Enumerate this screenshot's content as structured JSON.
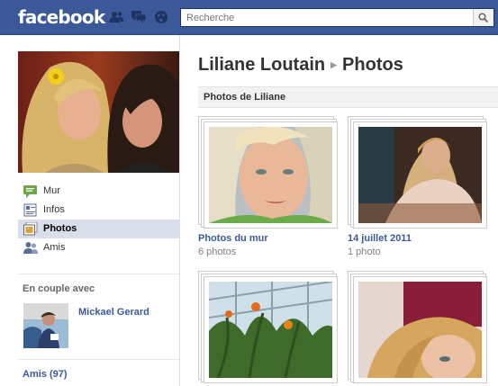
{
  "topbar": {
    "logo": "facebook",
    "search_placeholder": "Recherche",
    "jewels": [
      "friend-requests-icon",
      "messages-icon",
      "notifications-icon"
    ],
    "search_button_icon": "search-icon"
  },
  "sidebar": {
    "nav": [
      {
        "label": "Mur",
        "icon": "wall-icon",
        "selected": false
      },
      {
        "label": "Infos",
        "icon": "info-icon",
        "selected": false
      },
      {
        "label": "Photos",
        "icon": "photos-icon",
        "selected": true
      },
      {
        "label": "Amis",
        "icon": "friends-icon",
        "selected": false
      }
    ],
    "relationship_heading": "En couple avec",
    "partner_name": "Mickael Gerard",
    "friends_link": "Amis (97)"
  },
  "main": {
    "profile_name": "Liliane Loutain",
    "section": "Photos",
    "photos_bar": "Photos de Liliane",
    "albums": [
      {
        "name": "Photos du mur",
        "count": "6 photos"
      },
      {
        "name": "14 juillet 2011",
        "count": "1 photo"
      },
      {
        "name": "",
        "count": ""
      },
      {
        "name": "",
        "count": ""
      }
    ]
  },
  "colors": {
    "brand_blue": "#3b5998",
    "selected_nav": "#d8dfea"
  }
}
